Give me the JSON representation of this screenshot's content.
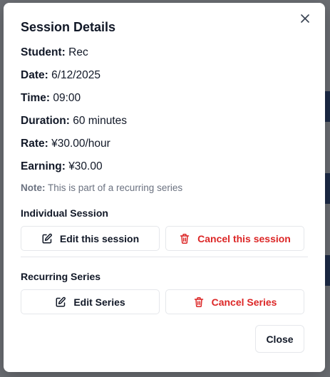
{
  "dialog": {
    "title": "Session Details",
    "close_icon": "close-icon"
  },
  "details": [
    {
      "label": "Student:",
      "value": "Rec"
    },
    {
      "label": "Date:",
      "value": "6/12/2025"
    },
    {
      "label": "Time:",
      "value": "09:00"
    },
    {
      "label": "Duration:",
      "value": "60 minutes"
    },
    {
      "label": "Rate:",
      "value": "¥30.00/hour"
    },
    {
      "label": "Earning:",
      "value": "¥30.00"
    }
  ],
  "note": {
    "label": "Note:",
    "text": "This is part of a recurring series"
  },
  "individual": {
    "heading": "Individual Session",
    "edit_label": "Edit this session",
    "edit_icon": "edit-icon",
    "cancel_label": "Cancel this session",
    "cancel_icon": "trash-icon"
  },
  "series": {
    "heading": "Recurring Series",
    "edit_label": "Edit Series",
    "edit_icon": "edit-icon",
    "cancel_label": "Cancel Series",
    "cancel_icon": "trash-icon"
  },
  "footer": {
    "close_label": "Close"
  },
  "colors": {
    "danger": "#dc2626",
    "text": "#111827",
    "muted": "#6b7280",
    "border": "#e5e7eb"
  }
}
